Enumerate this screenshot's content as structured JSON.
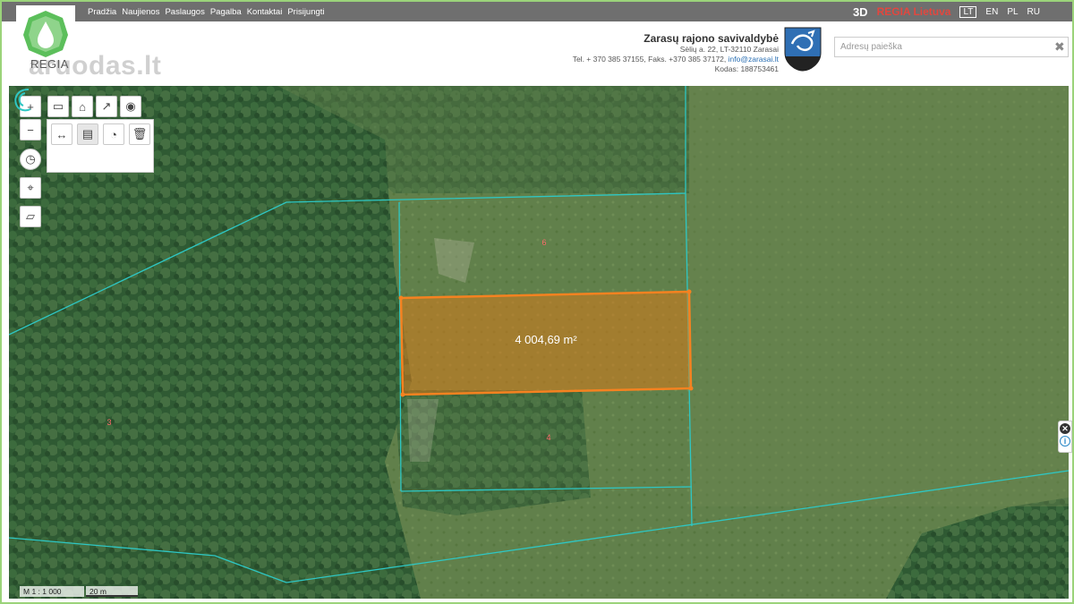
{
  "nav": {
    "items": [
      "Pradžia",
      "Naujienos",
      "Paslaugos",
      "Pagalba",
      "Kontaktai",
      "Prisijungti"
    ]
  },
  "header": {
    "mode_3d": "3D",
    "regia_link": "REGIA Lietuva",
    "languages": [
      "LT",
      "EN",
      "PL",
      "RU"
    ],
    "active_language": "LT",
    "logo_text": "REGIA",
    "watermark": "aruodas.lt"
  },
  "municipality": {
    "name": "Zarasų rajono savivaldybė",
    "address": "Sėlių a. 22, LT-32110 Zarasai",
    "phone": "Tel. + 370 385 37155, Faks. +370 385 37172,",
    "email": "info@zarasai.lt",
    "code": "Kodas: 188753461"
  },
  "search": {
    "placeholder": "Adresų paieška",
    "clear_symbol": "✖"
  },
  "tools": {
    "zoom_in": "+",
    "zoom_out": "−",
    "history": "◷",
    "locate": "⌖",
    "region": "▱",
    "measure": "▭",
    "marker": "⌂",
    "share": "↗",
    "point": "◉",
    "distance": "↔",
    "area": "▤",
    "radius": "◔",
    "trash": "🗑"
  },
  "map": {
    "area_label": "4 004,69 m²",
    "parcel_labels": [
      "6",
      "4",
      "3"
    ],
    "scale_ratio": "M 1 : 1 000",
    "scale_distance": "20 m"
  },
  "side": {
    "close": "✕",
    "info": "i"
  },
  "colors": {
    "topbar": "#6f6f6f",
    "regia_red": "#e2473f",
    "parcel_fill": "#d97a1a",
    "parcel_stroke": "#f58220",
    "cadastral_line": "#2ec7c4",
    "frame_border": "#9bd37a"
  }
}
